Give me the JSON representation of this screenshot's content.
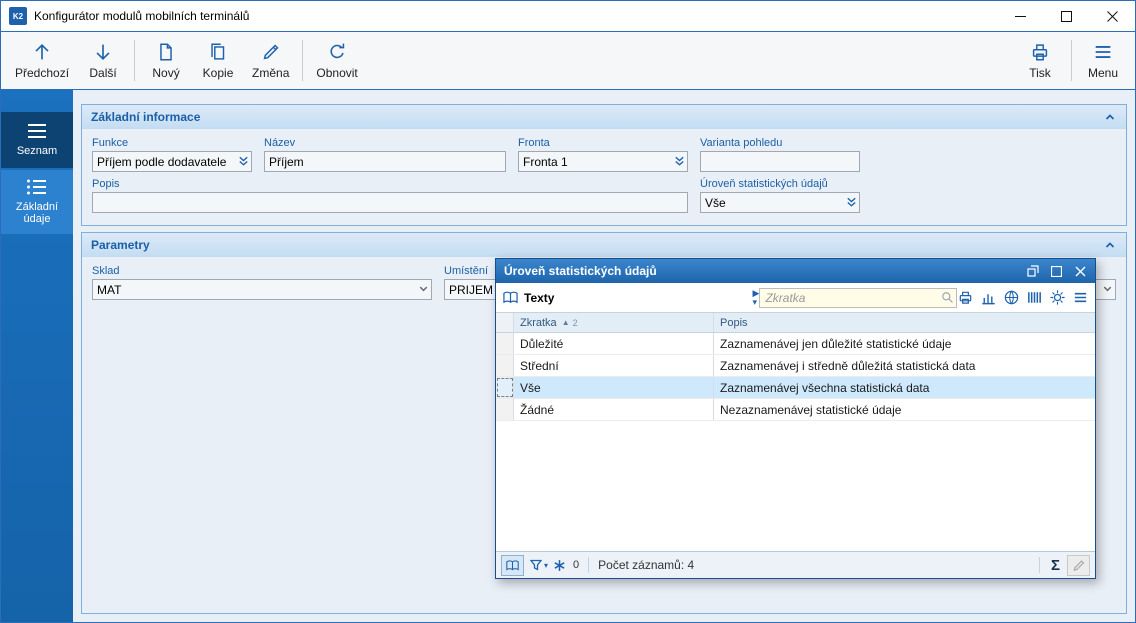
{
  "window": {
    "title": "Konfigurátor modulů mobilních terminálů",
    "icon_text": "K2"
  },
  "toolbar": {
    "buttons": [
      {
        "label": "Předchozí",
        "icon": "arrow-up-icon"
      },
      {
        "label": "Další",
        "icon": "arrow-down-icon"
      },
      {
        "label": "Nový",
        "icon": "new-document-icon"
      },
      {
        "label": "Kopie",
        "icon": "copy-icon"
      },
      {
        "label": "Změna",
        "icon": "pencil-icon"
      },
      {
        "label": "Obnovit",
        "icon": "refresh-icon"
      }
    ],
    "right_buttons": [
      {
        "label": "Tisk",
        "icon": "printer-icon"
      },
      {
        "label": "Menu",
        "icon": "menu-icon"
      }
    ]
  },
  "sidebar": {
    "items": [
      {
        "label": "Seznam",
        "icon": "list-icon"
      },
      {
        "label": "Základní údaje",
        "icon": "detail-list-icon"
      }
    ]
  },
  "groups": {
    "zakladni_informace": {
      "title": "Základní informace",
      "fields": {
        "funkce": {
          "label": "Funkce",
          "value": "Příjem podle dodavatele"
        },
        "nazev": {
          "label": "Název",
          "value": "Příjem"
        },
        "fronta": {
          "label": "Fronta",
          "value": "Fronta 1"
        },
        "varianta": {
          "label": "Varianta pohledu",
          "value": ""
        },
        "popis": {
          "label": "Popis",
          "value": ""
        },
        "uroven": {
          "label": "Úroveň statistických údajů",
          "value": "Vše"
        }
      }
    },
    "parametry": {
      "title": "Parametry",
      "fields": {
        "sklad": {
          "label": "Sklad",
          "value": "MAT"
        },
        "umisteni": {
          "label": "Umístění",
          "value": "PRIJEM KR"
        }
      }
    }
  },
  "popup": {
    "title": "Úroveň statistických údajů",
    "toolbar": {
      "section_label": "Texty",
      "search_placeholder": "Zkratka"
    },
    "table": {
      "columns": [
        {
          "label": "Zkratka",
          "sort_indicator": "▲",
          "sort_order": "2"
        },
        {
          "label": "Popis"
        }
      ],
      "rows": [
        {
          "zkratka": "Důležité",
          "popis": "Zaznamenávej jen důležité statistické údaje",
          "selected": false
        },
        {
          "zkratka": "Střední",
          "popis": "Zaznamenávej i středně důležitá statistická data",
          "selected": false
        },
        {
          "zkratka": "Vše",
          "popis": "Zaznamenávej všechna statistická data",
          "selected": true
        },
        {
          "zkratka": "Žádné",
          "popis": "Nezaznamenávej statistické údaje",
          "selected": false
        }
      ]
    },
    "statusbar": {
      "filter_count": "0",
      "record_count_label": "Počet záznamů: 4",
      "sigma": "Σ"
    }
  },
  "icons": {
    "app-logo": "K2",
    "minimize-icon": "—",
    "maximize-icon": "□",
    "close-icon": "✕",
    "arrow-up-icon": "↑",
    "arrow-down-icon": "↓",
    "new-document-icon": "blank page",
    "copy-icon": "two pages",
    "pencil-icon": "✎",
    "refresh-icon": "⟳",
    "printer-icon": "printer",
    "menu-icon": "☰",
    "list-icon": "☰",
    "detail-list-icon": "≔",
    "collapse-chevron-icon": "∧",
    "dropdown-icon": "⌄",
    "book-icon": "open book",
    "search-icon": "⌕",
    "chart-icon": "bar chart",
    "web-icon": "globe",
    "barcode-icon": "|||",
    "settings-icon": "⚙",
    "filter-icon": "funnel",
    "match-icon": "✳",
    "sum-icon": "Σ",
    "dock-icon": "⧉"
  },
  "colors": {
    "accent_blue": "#1e62ae",
    "window_border": "#2a6db8",
    "sidebar_blue": "#1b71bf",
    "sidebar_item_dark": "#0d4373",
    "sidebar_item_light": "#2c82cf",
    "group_header_bg": "#cfe2f5",
    "group_header_text": "#1a5fa5",
    "content_bg": "#e9eff7",
    "popup_title_bg": "#2a74c2",
    "selected_row": "#cfe9fc",
    "search_bg": "#fffde8"
  }
}
